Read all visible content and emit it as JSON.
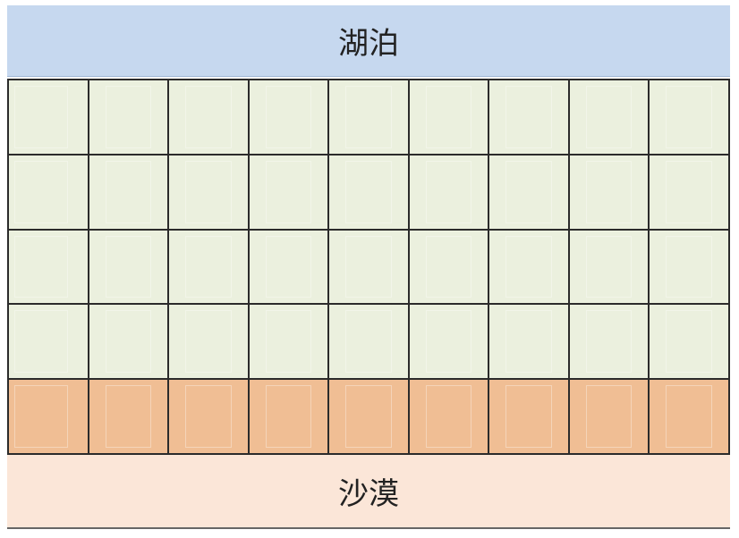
{
  "diagram": {
    "top_label": "湖泊",
    "bottom_label": "沙漠",
    "grid": {
      "columns": 9,
      "rows": [
        {
          "kind": "green"
        },
        {
          "kind": "green"
        },
        {
          "kind": "green"
        },
        {
          "kind": "green"
        },
        {
          "kind": "orange"
        }
      ]
    },
    "colors": {
      "lake": "#c6d8ef",
      "green": "#ebf0de",
      "orange": "#f0be94",
      "desert": "#fbe6d8",
      "line": "#2b2b2b"
    }
  }
}
